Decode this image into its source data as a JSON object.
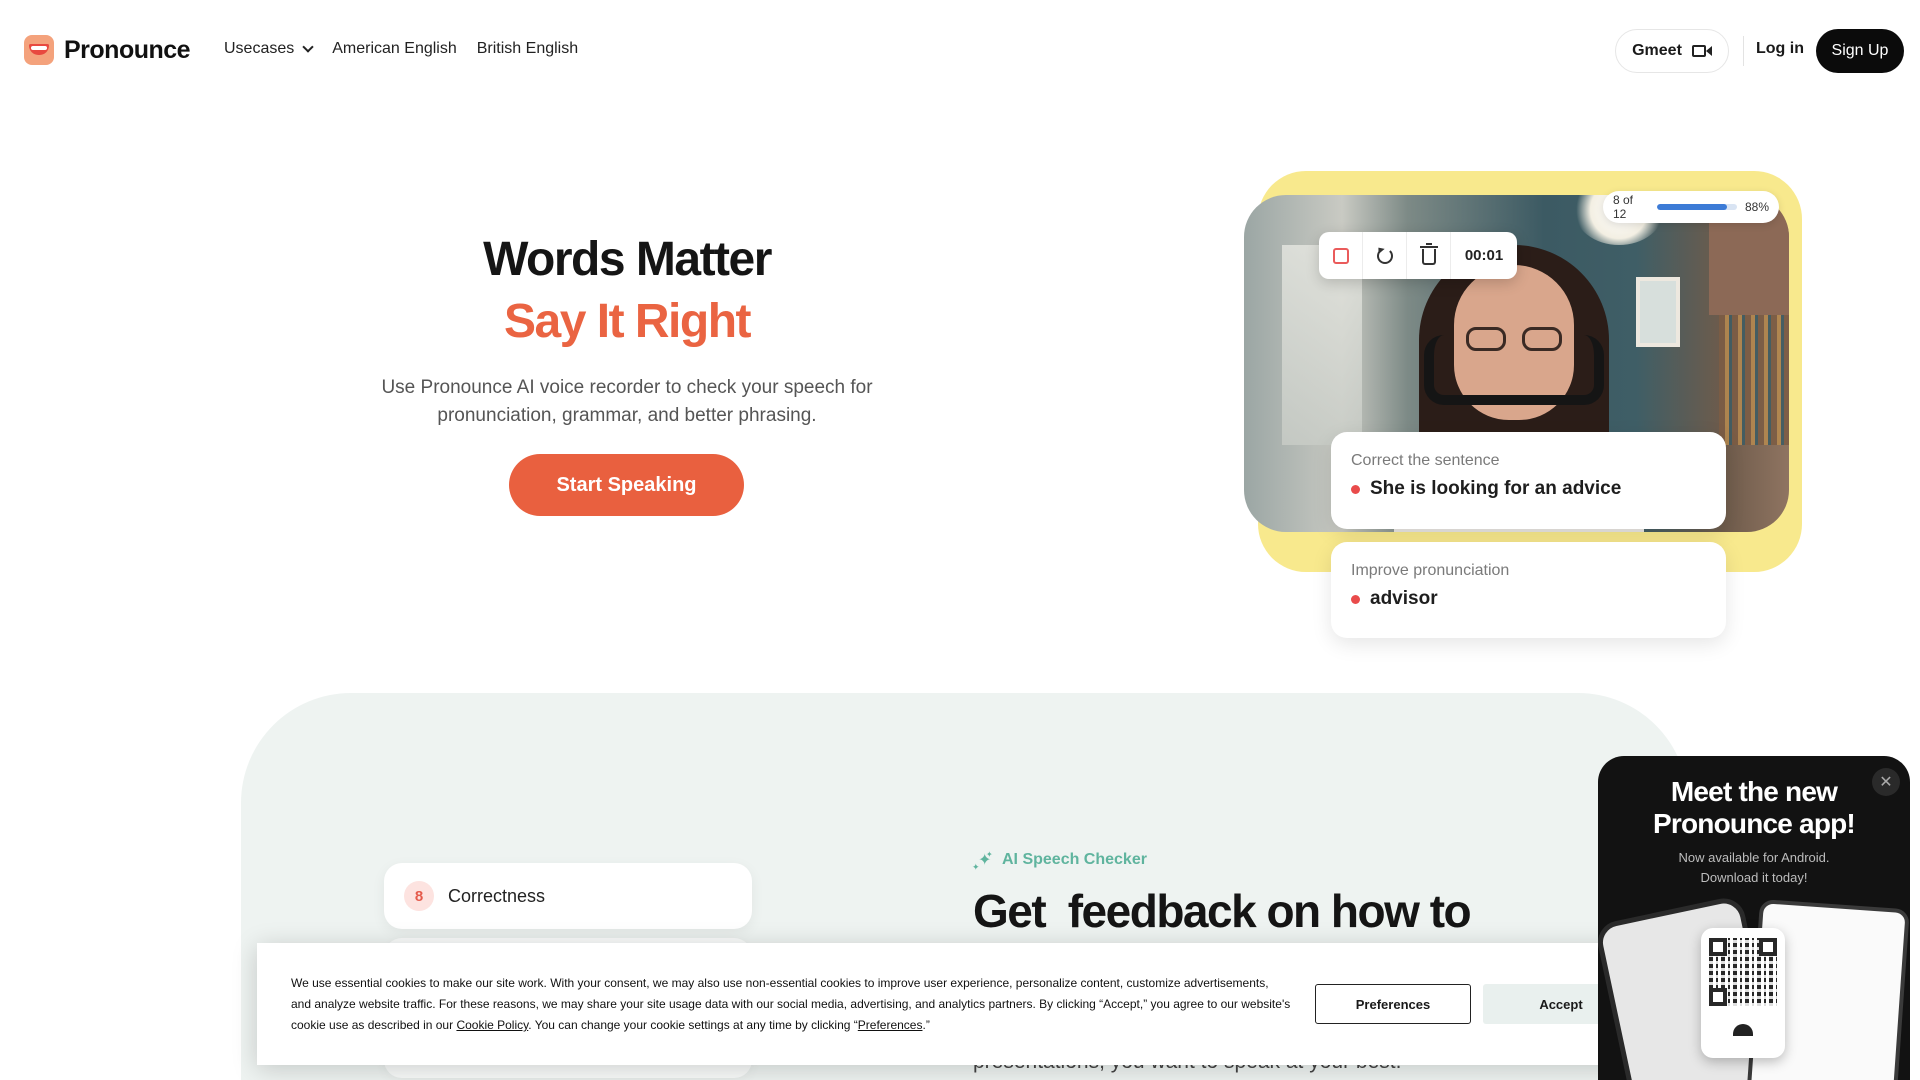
{
  "nav": {
    "brand": "Pronounce",
    "links": [
      {
        "label": "Usecases",
        "has_dropdown": true
      },
      {
        "label": "American English"
      },
      {
        "label": "British English"
      }
    ],
    "gmeet_label": "Gmeet",
    "login_label": "Log in",
    "signup_label": "Sign Up"
  },
  "hero": {
    "title": "Words Matter",
    "subtitle": "Say It Right",
    "description": "Use Pronounce AI voice recorder to check your speech for pronunciation, grammar, and better phrasing.",
    "cta": "Start Speaking"
  },
  "demo": {
    "timer": "00:01",
    "progress_text": "8 of 12",
    "progress_percent_label": "88%",
    "progress_fraction": 0.88,
    "cards": [
      {
        "label": "Correct the sentence",
        "value": "She is looking for an advice"
      },
      {
        "label": "Improve pronunciation",
        "value": "advisor"
      }
    ],
    "accent_colors": {
      "yellow": "#f8e98d",
      "orange": "#e9603f",
      "red_dot": "#e94b4b"
    }
  },
  "section2": {
    "metrics": [
      {
        "score": "8",
        "label": "Correctness"
      }
    ],
    "tag": "AI Speech Checker",
    "heading": "Get  feedback on how to",
    "partial_text": "presentations, you want to speak at your best."
  },
  "cookie": {
    "text_before_link": "We use essential cookies to make our site work. With your consent, we may also use non-essential cookies to improve user experience, personalize content, customize advertisements, and analyze website traffic. For these reasons, we may share your site usage data with our social media, advertising, and analytics partners. By clicking “Accept,” you agree to our website's cookie use as described in our ",
    "policy_link": "Cookie Policy",
    "text_middle": ". You can change your cookie settings at any time by clicking “",
    "preferences_link": "Preferences",
    "text_end": ".”",
    "preferences_button": "Preferences",
    "accept_button": "Accept"
  },
  "promo": {
    "title_line1": "Meet the new",
    "title_line2": "Pronounce app!",
    "sub_line1": "Now available for Android.",
    "sub_line2": "Download it today!",
    "close_symbol": "✕"
  }
}
